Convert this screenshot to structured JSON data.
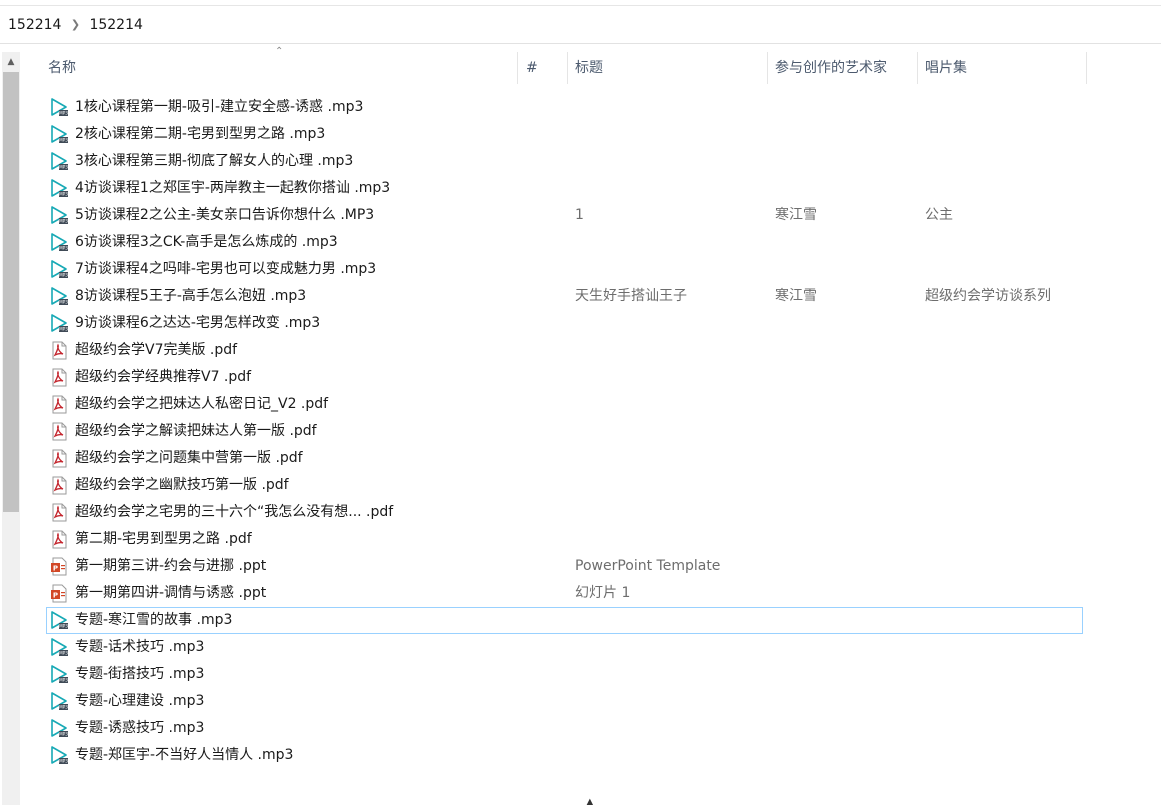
{
  "breadcrumb": [
    "152214",
    "152214"
  ],
  "columns": {
    "name": "名称",
    "number": "#",
    "title": "标题",
    "artists": "参与创作的艺术家",
    "album": "唱片集"
  },
  "files": [
    {
      "name": "1核心课程第一期-吸引-建立安全感-诱惑 .mp3",
      "type": "mp3",
      "number": "",
      "title": "",
      "artist": "",
      "album": ""
    },
    {
      "name": "2核心课程第二期-宅男到型男之路 .mp3",
      "type": "mp3",
      "number": "",
      "title": "",
      "artist": "",
      "album": ""
    },
    {
      "name": "3核心课程第三期-彻底了解女人的心理 .mp3",
      "type": "mp3",
      "number": "",
      "title": "",
      "artist": "",
      "album": ""
    },
    {
      "name": "4访谈课程1之郑匡宇-两岸教主一起教你搭讪 .mp3",
      "type": "mp3",
      "number": "",
      "title": "",
      "artist": "",
      "album": ""
    },
    {
      "name": "5访谈课程2之公主-美女亲口告诉你想什么 .MP3",
      "type": "mp3",
      "number": "",
      "title": "1",
      "artist": "寒江雪",
      "album": "公主"
    },
    {
      "name": "6访谈课程3之CK-高手是怎么炼成的 .mp3",
      "type": "mp3",
      "number": "",
      "title": "",
      "artist": "",
      "album": ""
    },
    {
      "name": "7访谈课程4之吗啡-宅男也可以变成魅力男 .mp3",
      "type": "mp3",
      "number": "",
      "title": "",
      "artist": "",
      "album": ""
    },
    {
      "name": "8访谈课程5王子-高手怎么泡妞 .mp3",
      "type": "mp3",
      "number": "",
      "title": "天生好手搭讪王子",
      "artist": "寒江雪",
      "album": "超级约会学访谈系列"
    },
    {
      "name": "9访谈课程6之达达-宅男怎样改变 .mp3",
      "type": "mp3",
      "number": "",
      "title": "",
      "artist": "",
      "album": ""
    },
    {
      "name": "超级约会学V7完美版 .pdf",
      "type": "pdf",
      "number": "",
      "title": "",
      "artist": "",
      "album": ""
    },
    {
      "name": "超级约会学经典推荐V7 .pdf",
      "type": "pdf",
      "number": "",
      "title": "",
      "artist": "",
      "album": ""
    },
    {
      "name": "超级约会学之把妹达人私密日记_V2 .pdf",
      "type": "pdf",
      "number": "",
      "title": "",
      "artist": "",
      "album": ""
    },
    {
      "name": "超级约会学之解读把妹达人第一版 .pdf",
      "type": "pdf",
      "number": "",
      "title": "",
      "artist": "",
      "album": ""
    },
    {
      "name": "超级约会学之问题集中营第一版 .pdf",
      "type": "pdf",
      "number": "",
      "title": "",
      "artist": "",
      "album": ""
    },
    {
      "name": "超级约会学之幽默技巧第一版 .pdf",
      "type": "pdf",
      "number": "",
      "title": "",
      "artist": "",
      "album": ""
    },
    {
      "name": "超级约会学之宅男的三十六个“我怎么没有想... .pdf",
      "type": "pdf",
      "number": "",
      "title": "",
      "artist": "",
      "album": ""
    },
    {
      "name": "第二期-宅男到型男之路 .pdf",
      "type": "pdf",
      "number": "",
      "title": "",
      "artist": "",
      "album": ""
    },
    {
      "name": "第一期第三讲-约会与进挪 .ppt",
      "type": "ppt",
      "number": "",
      "title": "PowerPoint Template",
      "artist": "",
      "album": ""
    },
    {
      "name": "第一期第四讲-调情与诱惑 .ppt",
      "type": "ppt",
      "number": "",
      "title": "幻灯片 1",
      "artist": "",
      "album": ""
    },
    {
      "name": "专题-寒江雪的故事 .mp3",
      "type": "mp3",
      "number": "",
      "title": "",
      "artist": "",
      "album": "",
      "selected": true
    },
    {
      "name": "专题-话术技巧 .mp3",
      "type": "mp3",
      "number": "",
      "title": "",
      "artist": "",
      "album": ""
    },
    {
      "name": "专题-街搭技巧 .mp3",
      "type": "mp3",
      "number": "",
      "title": "",
      "artist": "",
      "album": ""
    },
    {
      "name": "专题-心理建设 .mp3",
      "type": "mp3",
      "number": "",
      "title": "",
      "artist": "",
      "album": ""
    },
    {
      "name": "专题-诱惑技巧 .mp3",
      "type": "mp3",
      "number": "",
      "title": "",
      "artist": "",
      "album": ""
    },
    {
      "name": "专题-郑匡宇-不当好人当情人 .mp3",
      "type": "mp3",
      "number": "",
      "title": "",
      "artist": "",
      "album": ""
    }
  ],
  "colors": {
    "selection_border": "#99d1ff",
    "header_text": "#4c5a6e",
    "mp3_icon": "#17a9b5",
    "pdf_icon": "#c4262e",
    "ppt_icon": "#d24726"
  },
  "icons": {
    "mp3": "audio-file-icon",
    "pdf": "pdf-file-icon",
    "ppt": "powerpoint-file-icon"
  }
}
